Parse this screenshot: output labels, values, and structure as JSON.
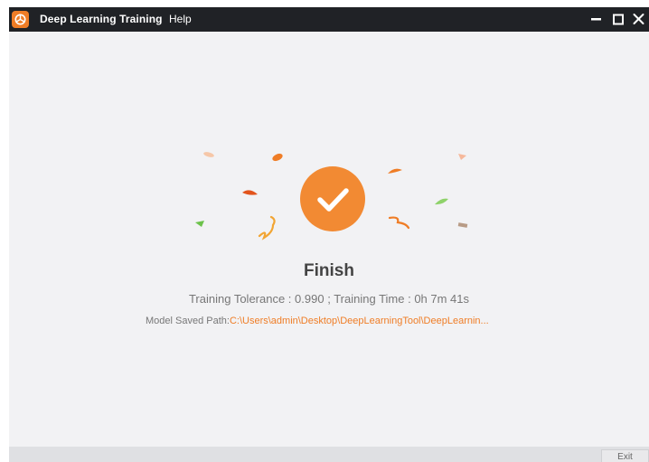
{
  "window": {
    "title": "Deep Learning Training",
    "menu": [
      "Help"
    ],
    "controls": [
      "minimize-icon",
      "maximize-icon",
      "close-icon"
    ]
  },
  "result": {
    "title": "Finish",
    "tolerance_label": "Training Tolerance : ",
    "tolerance_value": "0.990",
    "separator": " ; ",
    "time_label": "Training Time : ",
    "time_value": "0h 7m 41s",
    "path_label": "Model Saved Path:",
    "path_value": "C:\\Users\\admin\\Desktop\\DeepLearningTool\\DeepLearnin..."
  },
  "footer": {
    "exit_label": "Exit"
  },
  "colors": {
    "titlebar": "#202226",
    "accent": "#ef7d26",
    "background": "#f2f2f4",
    "text_muted": "#777777"
  }
}
